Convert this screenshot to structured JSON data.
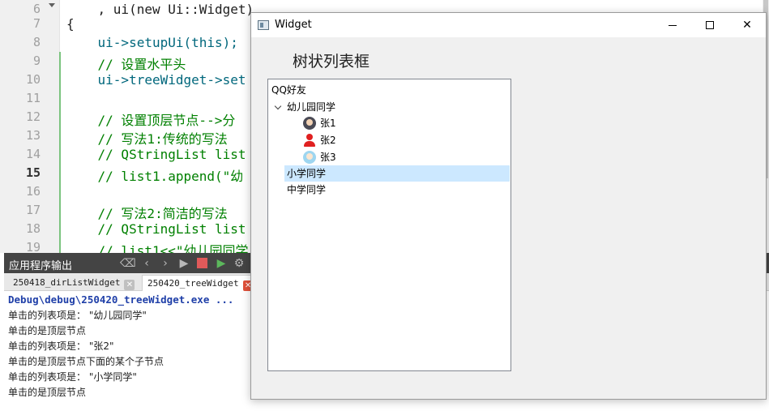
{
  "editor": {
    "lines": [
      {
        "no": "6",
        "text": "    , ui(new Ui::Widget)"
      },
      {
        "no": "7",
        "text": "{"
      },
      {
        "no": "8",
        "text": "    ui->setupUi(this);"
      },
      {
        "no": "9",
        "text": "    // 设置水平头"
      },
      {
        "no": "10",
        "text": "    ui->treeWidget->set"
      },
      {
        "no": "11",
        "text": ""
      },
      {
        "no": "12",
        "text": "    // 设置顶层节点-->分"
      },
      {
        "no": "13",
        "text": "    // 写法1:传统的写法"
      },
      {
        "no": "14",
        "text": "    // QStringList list"
      },
      {
        "no": "15",
        "text": "    // list1.append(\"幼"
      },
      {
        "no": "16",
        "text": ""
      },
      {
        "no": "17",
        "text": "    // 写法2:简洁的写法"
      },
      {
        "no": "18",
        "text": "    // QStringList list"
      },
      {
        "no": "19",
        "text": "    // list1<<\"幼儿园同学"
      }
    ],
    "current_line": "15"
  },
  "output": {
    "title": "应用程序输出",
    "tabs": [
      {
        "label": "250418_dirListWidget"
      },
      {
        "label": "250420_treeWidget"
      }
    ],
    "close_glyph": "✕",
    "lines": [
      "Debug\\debug\\250420_treeWidget.exe ...",
      "单击的列表项是： \"幼儿园同学\"",
      "单击的是顶层节点",
      "单击的列表项是： \"张2\"",
      "单击的是顶层节点下面的某个子节点",
      "单击的列表项是： \"小学同学\"",
      "单击的是顶层节点"
    ]
  },
  "window": {
    "title": "Widget",
    "close_glyph": "✕",
    "heading": "树状列表框",
    "tree": {
      "header": "QQ好友",
      "items": [
        {
          "label": "幼儿园同学",
          "expanded": true
        },
        {
          "label": "张1",
          "icon": "avatar-icon"
        },
        {
          "label": "张2",
          "icon": "person-icon"
        },
        {
          "label": "张3",
          "icon": "avatar-icon"
        },
        {
          "label": "小学同学",
          "selected": true
        },
        {
          "label": "中学同学"
        }
      ],
      "colors": {
        "selection": "#cce8ff"
      }
    }
  }
}
